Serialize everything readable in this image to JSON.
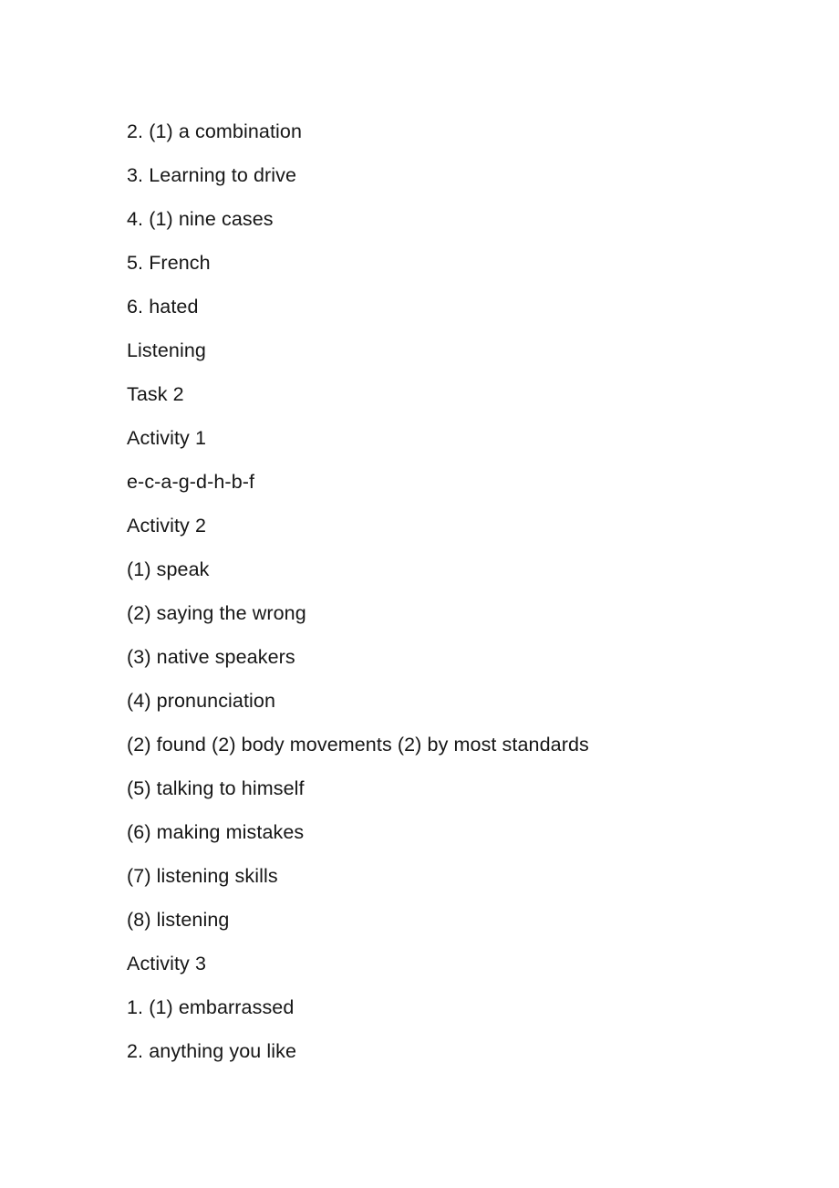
{
  "document": {
    "background_color": "#ffffff",
    "text_color": "#161616",
    "lines": [
      {
        "id": "line-1",
        "text": "2. (1) a combination"
      },
      {
        "id": "line-2",
        "text": "3. Learning to drive"
      },
      {
        "id": "line-3",
        "text": "4. (1) nine cases"
      },
      {
        "id": "line-4",
        "text": "5. French"
      },
      {
        "id": "line-5",
        "text": "6. hated"
      },
      {
        "id": "line-6",
        "text": "Listening"
      },
      {
        "id": "line-7",
        "text": "Task 2"
      },
      {
        "id": "line-8",
        "text": "Activity 1"
      },
      {
        "id": "line-9",
        "text": "e-c-a-g-d-h-b-f"
      },
      {
        "id": "line-10",
        "text": "Activity 2"
      },
      {
        "id": "line-11",
        "text": "(1) speak"
      },
      {
        "id": "line-12",
        "text": "(2) saying the wrong"
      },
      {
        "id": "line-13",
        "text": "(3) native speakers"
      },
      {
        "id": "line-14",
        "text": "(4) pronunciation"
      },
      {
        "id": "line-15",
        "text": "(2) found (2) body movements (2) by most standards"
      },
      {
        "id": "line-16",
        "text": "(5) talking to himself"
      },
      {
        "id": "line-17",
        "text": "(6) making mistakes"
      },
      {
        "id": "line-18",
        "text": "(7) listening skills"
      },
      {
        "id": "line-19",
        "text": "(8) listening"
      },
      {
        "id": "line-20",
        "text": "Activity 3"
      },
      {
        "id": "line-21",
        "text": "1. (1) embarrassed"
      },
      {
        "id": "line-22",
        "text": "2. anything you like"
      }
    ]
  }
}
